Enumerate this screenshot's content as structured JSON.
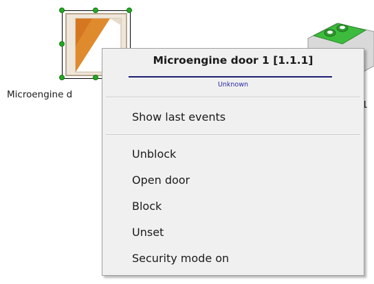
{
  "canvas": {
    "door_object": {
      "icon": "door-icon",
      "label": "Microengine d",
      "selected": true
    },
    "module_object": {
      "icon": "green-module-icon",
      "label_tail": ".1"
    }
  },
  "context_menu": {
    "title": "Microengine door 1 [1.1.1]",
    "status": "Unknown",
    "items": [
      {
        "label": "Show last events"
      },
      {
        "label": "Unblock"
      },
      {
        "label": "Open door"
      },
      {
        "label": "Block"
      },
      {
        "label": "Unset"
      },
      {
        "label": "Security mode on"
      }
    ]
  },
  "colors": {
    "door_orange": "#e08a2e",
    "door_frame": "#c8b49a",
    "selection_handle": "#22aa22",
    "title_underline": "#1a1a6e",
    "status_text": "#2a2aa8",
    "module_green": "#3dbb3d",
    "menu_background": "#f0f0f0"
  }
}
